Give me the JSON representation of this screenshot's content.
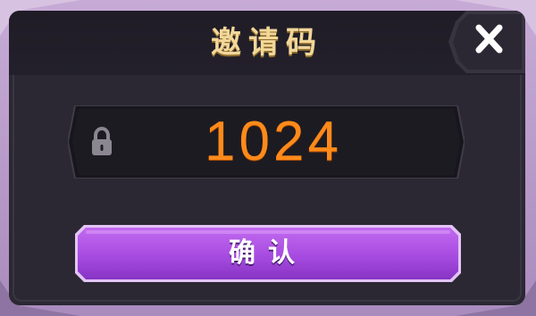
{
  "dialog": {
    "title": "邀请码",
    "close_icon": "close-icon",
    "code_input": {
      "value": "1024",
      "icon": "lock-icon"
    },
    "confirm_label": "确认"
  },
  "colors": {
    "title": "#f2d79a",
    "code": "#ff8a1a",
    "button": "#a74be0",
    "panel": "#2b2833",
    "frame": "#c7abd6"
  }
}
